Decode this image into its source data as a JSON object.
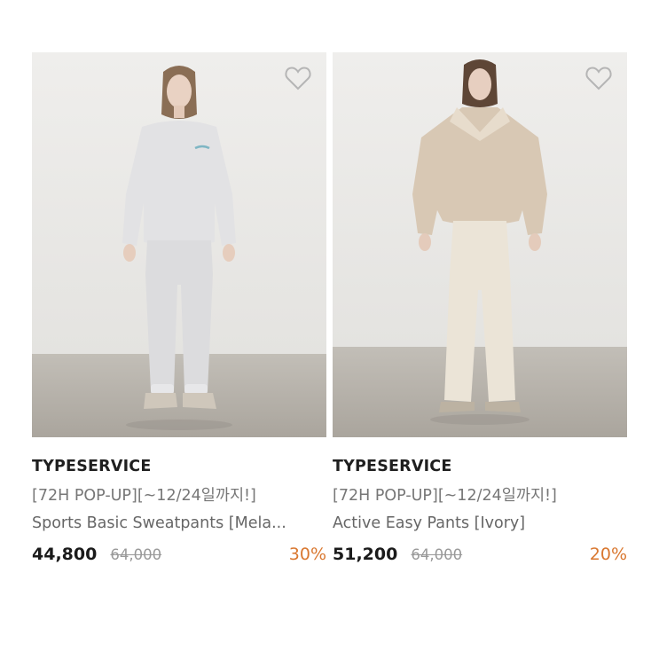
{
  "products": [
    {
      "brand": "TYPESERVICE",
      "promo": "[72H POP-UP][~12/24일까지!]",
      "name": "Sports Basic Sweatpants [Mela...",
      "price": "44,800",
      "original_price": "64,000",
      "discount": "30%",
      "wishlist_icon": "heart-outline-icon",
      "image_subject": "model-gray-sweatshirt-sweatpants"
    },
    {
      "brand": "TYPESERVICE",
      "promo": "[72H POP-UP][~12/24일까지!]",
      "name": "Active Easy Pants [Ivory]",
      "price": "51,200",
      "original_price": "64,000",
      "discount": "20%",
      "wishlist_icon": "heart-outline-icon",
      "image_subject": "model-beige-fur-jacket-ivory-pants"
    }
  ],
  "colors": {
    "discount": "#d9772f",
    "brand_text": "#1f1f1f",
    "muted_text": "#777777",
    "wall": "#ecebe9",
    "floor": "#b9b5ae"
  }
}
